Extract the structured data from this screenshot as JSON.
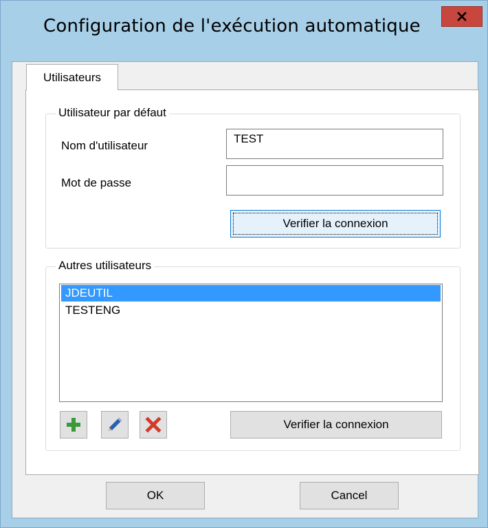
{
  "window": {
    "title": "Configuration de l'exécution automatique",
    "close_glyph": "x"
  },
  "tabs": [
    {
      "label": "Utilisateurs",
      "selected": true
    }
  ],
  "default_user": {
    "legend": "Utilisateur par défaut",
    "username_label": "Nom d'utilisateur",
    "username_value": "TEST",
    "password_label": "Mot de passe",
    "password_value": "",
    "verify_label": "Verifier la connexion"
  },
  "other_users": {
    "legend": "Autres utilisateurs",
    "items": [
      {
        "label": "JDEUTIL",
        "selected": true
      },
      {
        "label": "TESTENG",
        "selected": false
      }
    ],
    "add_icon": "plus-icon",
    "edit_icon": "pencil-icon",
    "delete_icon": "delete-x-icon",
    "verify_label": "Verifier la connexion"
  },
  "footer": {
    "ok_label": "OK",
    "cancel_label": "Cancel"
  },
  "colors": {
    "title_bg": "#a7cfe8",
    "close_bg": "#c7473f",
    "selection": "#3399ff",
    "add_green": "#3a9a3a",
    "edit_blue": "#2a5fb0",
    "delete_red": "#d23a2a"
  }
}
